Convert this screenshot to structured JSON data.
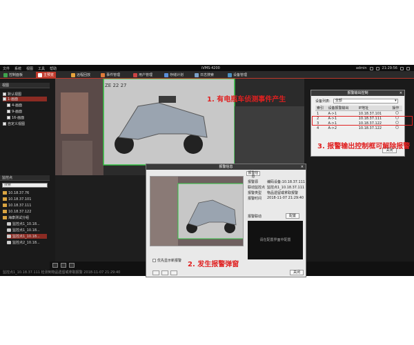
{
  "menubar": {
    "menus": [
      "文件",
      "系统",
      "视图",
      "工具",
      "帮助"
    ],
    "title": "iVMS-4200",
    "user": "admin",
    "time": "21:29:56"
  },
  "tabs": [
    {
      "label": "控制面板",
      "icon": "dashboard-icon",
      "color": "#3fa34d"
    },
    {
      "label": "主预览",
      "icon": "live-view-icon",
      "color": "#d9534f",
      "active": true
    },
    {
      "label": "远程回放",
      "icon": "playback-icon",
      "color": "#e8a33c"
    },
    {
      "label": "事件管理",
      "icon": "event-icon",
      "color": "#e07b39"
    },
    {
      "label": "用户管理",
      "icon": "user-icon",
      "color": "#cc4444"
    },
    {
      "label": "存储计划",
      "icon": "storage-icon",
      "color": "#5a8fd8"
    },
    {
      "label": "日志搜索",
      "icon": "log-icon",
      "color": "#7aa0c8"
    },
    {
      "label": "设备管理",
      "icon": "device-icon",
      "color": "#4a90c0"
    }
  ],
  "view_panel": {
    "title": "视图",
    "items": [
      "默认视图",
      "1-画面",
      "4-画面",
      "9-画面",
      "16-画面",
      "自定义视图"
    ]
  },
  "monitor_panel": {
    "title": "监控点",
    "search_placeholder": "搜索",
    "items": [
      "10.18.37.76",
      "10.18.37.101",
      "10.18.37.111",
      "10.18.37.122",
      "海康测试分组",
      "监控点1_10.18...",
      "监控点1_10.18...",
      "监控点1_10.18...",
      "监控点2_10.18..."
    ]
  },
  "video": {
    "overlay_text": "ZE 22 27"
  },
  "output_dialog": {
    "title": "报警输出控制",
    "device_label": "设备列表:",
    "device_value": "全部",
    "columns": [
      "索引",
      "设备报警输出",
      "IP地址",
      "操作"
    ],
    "rows": [
      [
        "1",
        "A->1",
        "10.18.37.101"
      ],
      [
        "2",
        "A->1",
        "10.18.37.111"
      ],
      [
        "3",
        "A->1",
        "10.18.37.122"
      ],
      [
        "4",
        "A->2",
        "10.18.37.122"
      ]
    ],
    "close": "关闭"
  },
  "alarm_dialog": {
    "title": "报警信息",
    "info_tab": "报警信息",
    "fields": [
      {
        "k": "报警源",
        "v": "编码设备:10.18.37.111"
      },
      {
        "k": "联动监控点",
        "v": "监控点1_10.18.37.111"
      },
      {
        "k": "报警类型",
        "v": "物品遗留或拿取报警"
      },
      {
        "k": "报警时间",
        "v": "2018-11-07 21:29:40"
      }
    ],
    "linkage_label": "报警联动",
    "config_btn": "配置",
    "dark_text": "请在配置界面中配置",
    "checkbox_label": "优先显示新报警",
    "close": "关闭"
  },
  "annotations": {
    "note1": "1. 有电瓶车侦测事件产生",
    "note2": "2. 发生报警弹窗",
    "note3": "3. 报警输出控制框可解除报警"
  },
  "status_text": "监控点1_10.18.37.111 检测到物品遗留或拿取报警 2018-11-07 21:29:40"
}
